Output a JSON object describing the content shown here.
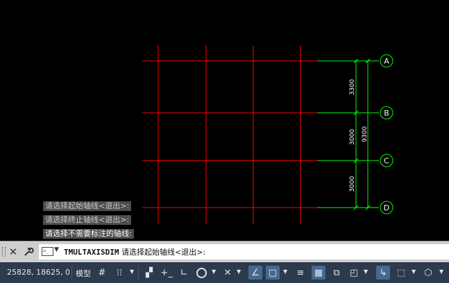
{
  "axes": {
    "labels": [
      "A",
      "B",
      "C",
      "D"
    ],
    "dims_small": [
      "3300",
      "3000",
      "3000"
    ],
    "dim_total": "9300"
  },
  "history": [
    "请选择起始轴线<退出>:",
    "请选择终止轴线<退出>:",
    "请选择不需要标注的轴线:"
  ],
  "command": {
    "name": "TMULTAXISDIM",
    "prompt": "请选择起始轴线<退出>:"
  },
  "status": {
    "coords": "25828, 18625, 0",
    "model": "模型"
  },
  "colors": {
    "grid_red": "#ff0000",
    "axis_green": "#00ff00",
    "dim_text": "#ffffff",
    "status_bg": "#2b3a4c",
    "active_blue": "#48688f"
  }
}
